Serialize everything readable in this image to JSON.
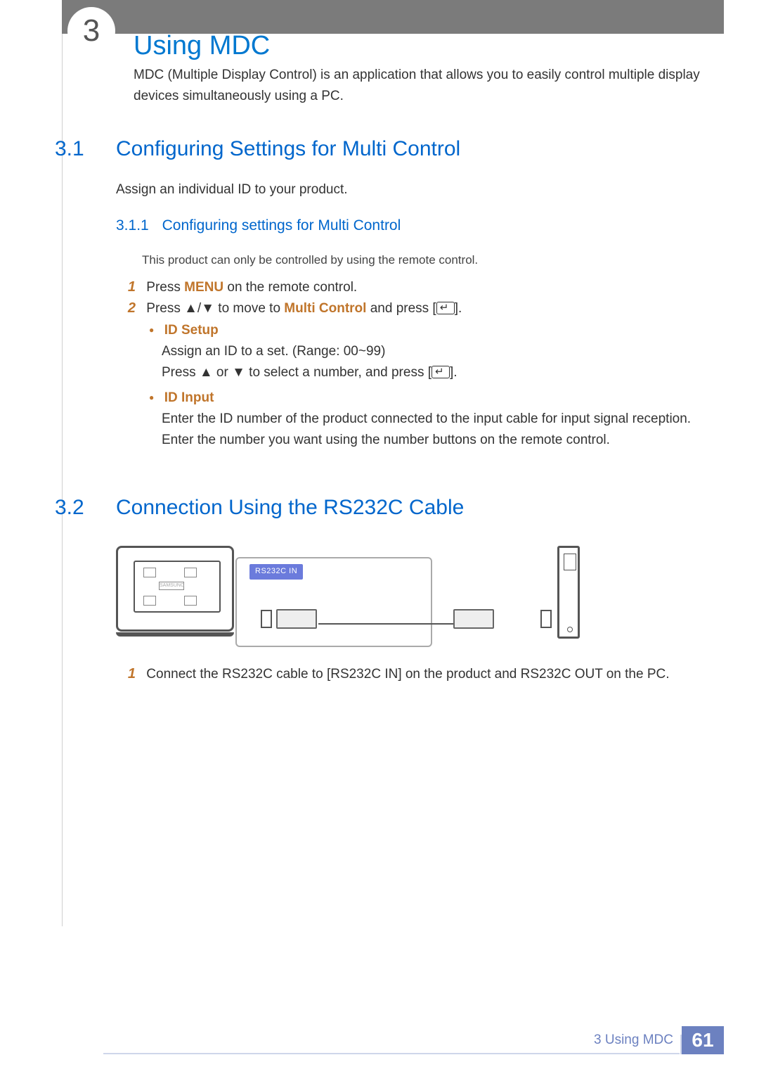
{
  "chapter_number_circle": "3",
  "chapter_title": "Using MDC",
  "intro": "MDC (Multiple Display Control) is an application that allows you to easily control multiple display devices simultaneously using a PC.",
  "section1": {
    "num": "3.1",
    "title": "Configuring Settings for Multi Control",
    "assign_text": "Assign an individual ID to your product.",
    "sub": {
      "num": "3.1.1",
      "title": "Configuring settings for Multi Control",
      "note": "This product can only be controlled by using the remote control.",
      "step1_num": "1",
      "step1_a": "Press ",
      "step1_menu": "MENU",
      "step1_b": " on the remote control.",
      "step2_num": "2",
      "step2_a": "Press ▲/▼ to move to ",
      "step2_mc": "Multi Control",
      "step2_b": " and press [",
      "step2_c": "].",
      "id_setup_title": "ID Setup",
      "id_setup_l1": "Assign an ID to a set. (Range: 00~99)",
      "id_setup_l2a": "Press ▲ or ▼ to select a number, and press [",
      "id_setup_l2b": "].",
      "id_input_title": "ID Input",
      "id_input_l1": "Enter the ID number of the product connected to the input cable for input signal reception.",
      "id_input_l2": "Enter the number you want using the number buttons on the remote control."
    }
  },
  "section2": {
    "num": "3.2",
    "title": "Connection Using the RS232C Cable",
    "diagram_port_label": "RS232C IN",
    "step1_num": "1",
    "step1_text": "Connect the RS232C cable to [RS232C IN] on the product and RS232C OUT on the PC."
  },
  "footer": {
    "chapter_ref": "3 Using MDC",
    "page": "61"
  }
}
